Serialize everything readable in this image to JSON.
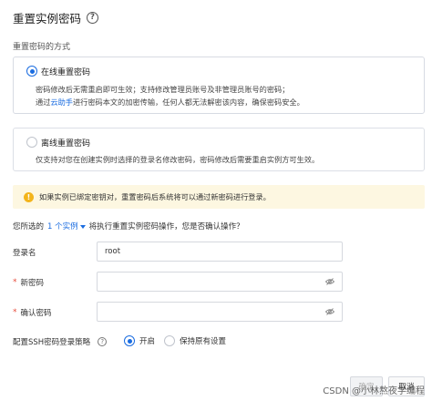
{
  "dialog": {
    "title": "重置实例密码",
    "help_icon": "help-circle-icon"
  },
  "method": {
    "label": "重置密码的方式",
    "online": {
      "title": "在线重置密码",
      "selected": true,
      "desc_line1": "密码修改后无需重启即可生效；支持修改管理员账号及非管理员账号的密码；",
      "desc_line2_prefix": "通过",
      "desc_line2_link": "云助手",
      "desc_line2_suffix": "进行密码本文的加密传输，任何人都无法解密该内容，确保密码安全。"
    },
    "offline": {
      "title": "离线重置密码",
      "selected": false,
      "desc": "仅支持对您在创建实例时选择的登录名修改密码，密码修改后需要重启实例方可生效。"
    }
  },
  "warning": {
    "icon": "warning-icon",
    "text": "如果实例已绑定密钥对，重置密码后系统将可以通过新密码进行登录。",
    "color": "#fdf7e1"
  },
  "selection": {
    "prefix": "您所选的",
    "link": "1 个实例",
    "suffix": "将执行重置实例密码操作，您是否确认操作？"
  },
  "form": {
    "login_label": "登录名",
    "login_value": "root",
    "new_password_label": "新密码",
    "confirm_password_label": "确认密码",
    "required_mark": "*",
    "eye_icon": "eye-off-icon",
    "ssh_label": "配置SSH密码登录策略",
    "ssh_options": [
      {
        "label": "开启",
        "selected": true
      },
      {
        "label": "保持原有设置",
        "selected": false
      }
    ]
  },
  "footer": {
    "confirm_label": "确定",
    "cancel_label": "取消"
  },
  "watermark": "CSDN @小林熬夜学编程",
  "colors": {
    "accent": "#1a6ce0",
    "warning_icon": "#f3b41b",
    "required": "#e74c3c"
  }
}
